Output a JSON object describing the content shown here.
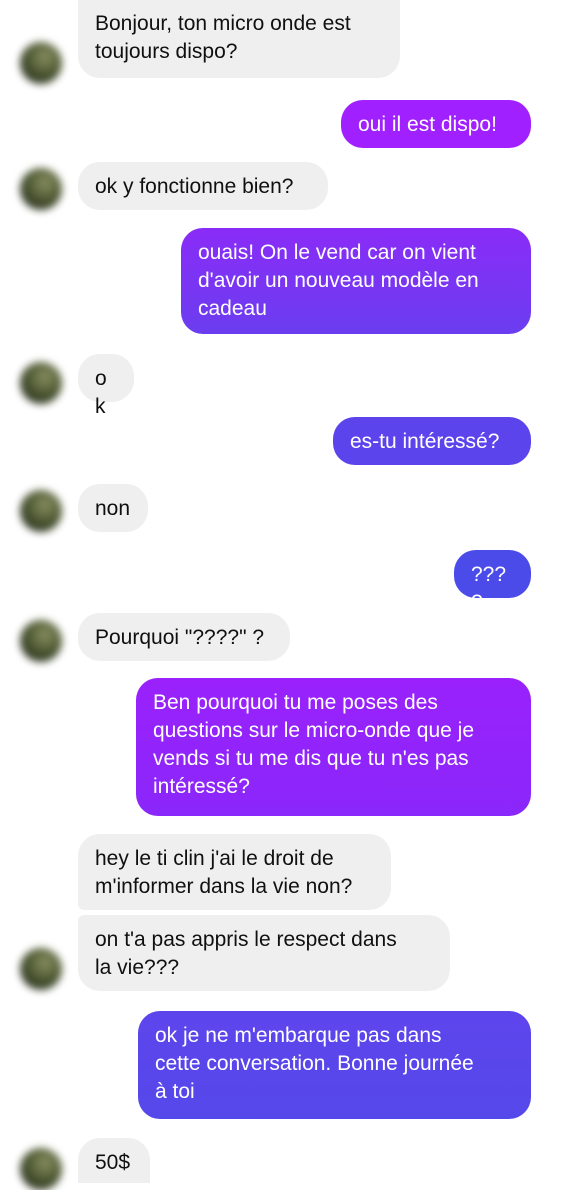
{
  "theme": {
    "incoming_bubble": "#efefef",
    "incoming_text": "#101010",
    "outgoing_text": "#ffffff",
    "outgoing_colors": [
      "#a020ff",
      "#8a2cf7",
      "#6b3df0",
      "#5b44ec",
      "#4d49e8",
      "#4a4be8",
      "#9a21fc",
      "#5847ea"
    ]
  },
  "messages": [
    {
      "from": "them",
      "text": "Bonjour, ton micro onde est\ntoujours dispo?"
    },
    {
      "from": "me",
      "text": "oui il est dispo!"
    },
    {
      "from": "them",
      "text": "ok y fonctionne bien?"
    },
    {
      "from": "me",
      "text": "ouais! On le vend car on vient\nd'avoir un nouveau modèle en\ncadeau"
    },
    {
      "from": "them",
      "text": "ok"
    },
    {
      "from": "me",
      "text": "es-tu intéressé?"
    },
    {
      "from": "them",
      "text": "non"
    },
    {
      "from": "me",
      "text": "????"
    },
    {
      "from": "them",
      "text": "Pourquoi \"????\" ?"
    },
    {
      "from": "me",
      "text": "Ben pourquoi tu me poses des\nquestions sur le micro-onde que je\nvends si tu me dis que tu n'es pas\nintéressé?"
    },
    {
      "from": "them",
      "text": "hey le ti clin j'ai le droit de\nm'informer dans la vie non?"
    },
    {
      "from": "them",
      "text": "on t'a pas appris le respect dans\nla vie???"
    },
    {
      "from": "me",
      "text": "ok je ne m'embarque pas dans\ncette conversation. Bonne journée\nà toi"
    },
    {
      "from": "them",
      "text": "50$"
    }
  ]
}
